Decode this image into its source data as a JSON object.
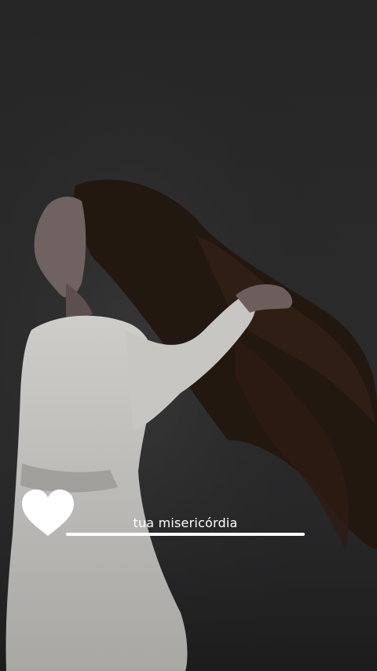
{
  "lyric": {
    "text": "tua misericórdia",
    "progress": 1.0
  },
  "heart": {
    "icon": "heart-icon",
    "color": "#ffffff"
  },
  "background": {
    "base_color": "#262626",
    "figure_color": "#d8d6d3",
    "hair_color": "#2a1b16"
  }
}
